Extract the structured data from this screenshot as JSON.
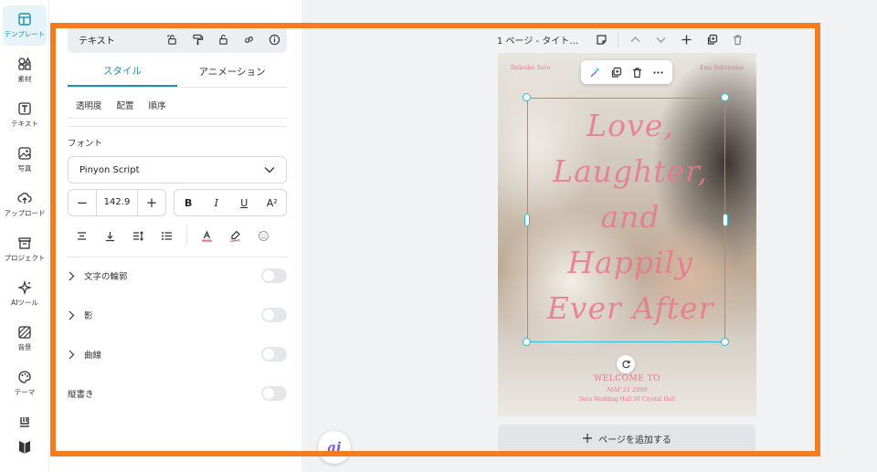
{
  "rail": {
    "items": [
      {
        "label": "テンプレート",
        "icon": "template-icon",
        "active": true
      },
      {
        "label": "素材",
        "icon": "elements-icon"
      },
      {
        "label": "テキスト",
        "icon": "text-icon"
      },
      {
        "label": "写真",
        "icon": "photo-icon"
      },
      {
        "label": "アップロード",
        "icon": "upload-icon"
      },
      {
        "label": "プロジェクト",
        "icon": "project-icon"
      },
      {
        "label": "AIツール",
        "icon": "ai-tools-icon"
      },
      {
        "label": "背景",
        "icon": "background-icon"
      },
      {
        "label": "テーマ",
        "icon": "theme-icon"
      }
    ]
  },
  "panel": {
    "title": "テキスト",
    "tabs": [
      "スタイル",
      "アニメーション"
    ],
    "subtabs": [
      "透明度",
      "配置",
      "順序"
    ],
    "font_label": "フォント",
    "font_value": "Pinyon Script",
    "font_size": "142.9",
    "format": {
      "bold": "B",
      "italic": "I",
      "underline": "U",
      "superscript": "A²"
    },
    "toggles": [
      {
        "label": "文字の輪郭",
        "expandable": true,
        "on": false
      },
      {
        "label": "影",
        "expandable": true,
        "on": false
      },
      {
        "label": "曲線",
        "expandable": true,
        "on": false
      },
      {
        "label": "縦書き",
        "expandable": false,
        "on": false
      }
    ],
    "accent_color": "#1a8fb0",
    "text_color_swatch": "#e8778f"
  },
  "canvas": {
    "page_title": "1 ページ - タイト…",
    "add_page_label": "ページを追加する",
    "ai_label": "ai",
    "design": {
      "name_left": "Daisuke Sato",
      "name_right": "Emi Yokoyama",
      "script_text": "Love, Laughter, and Happily Ever After",
      "script_lines": [
        "Love,",
        "Laughter,",
        "and",
        "Happily",
        "Ever After"
      ],
      "welcome": "WELCOME TO",
      "date": "MAY 21 2099",
      "venue": "Sora Wedding Hall 38 Crystal Hall",
      "text_color": "#e8778f"
    },
    "selection_color": "#33b8d6"
  },
  "highlight_color": "#f47c20"
}
